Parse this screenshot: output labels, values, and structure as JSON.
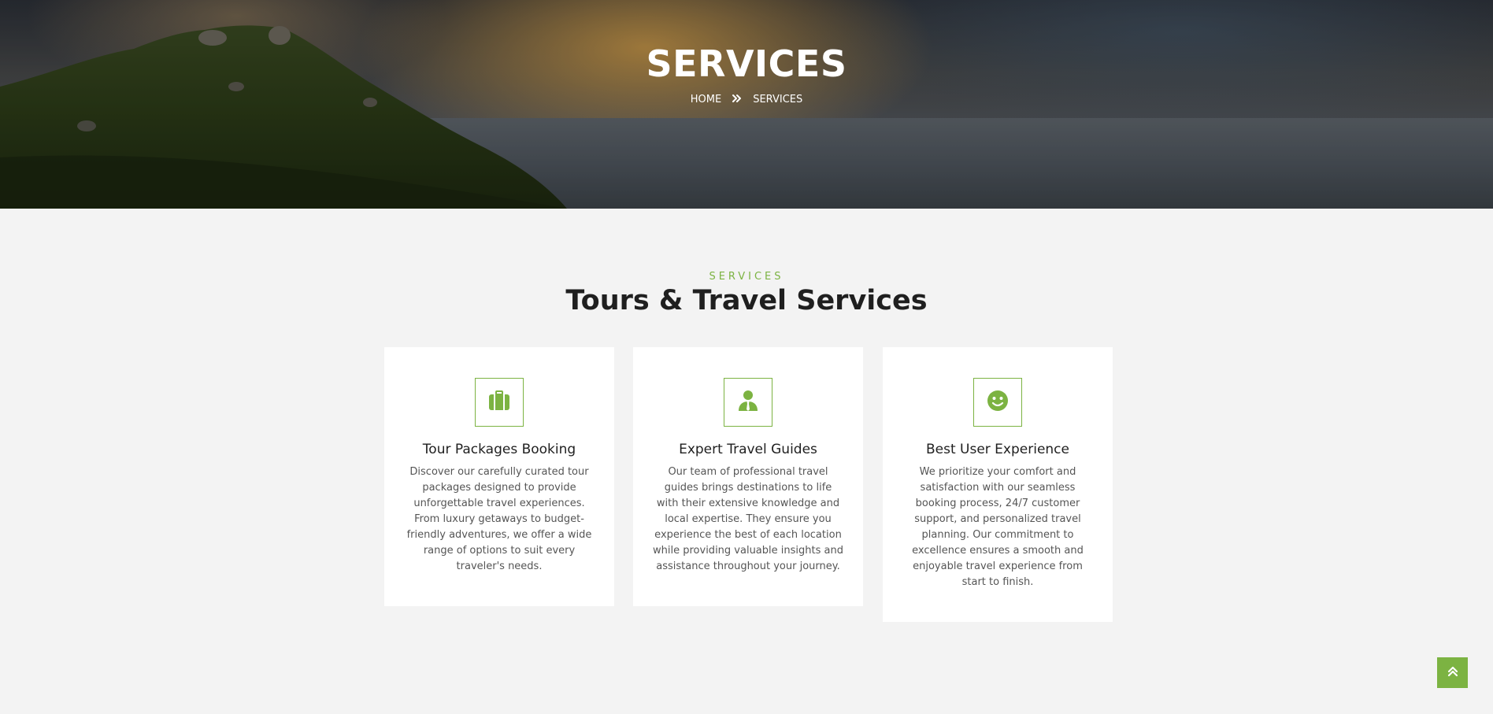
{
  "hero": {
    "title": "SERVICES",
    "breadcrumb": {
      "home": "HOME",
      "separator_icon": "double-chevron-right-icon",
      "current": "SERVICES"
    }
  },
  "section": {
    "eyebrow": "SERVICES",
    "title": "Tours & Travel Services"
  },
  "cards": [
    {
      "icon": "suitcase-icon",
      "title": "Tour Packages Booking",
      "text": "Discover our carefully curated tour packages designed to provide unforgettable travel experiences. From luxury getaways to budget-friendly adventures, we offer a wide range of options to suit every traveler's needs."
    },
    {
      "icon": "user-tie-icon",
      "title": "Expert Travel Guides",
      "text": "Our team of professional travel guides brings destinations to life with their extensive knowledge and local expertise. They ensure you experience the best of each location while providing valuable insights and assistance throughout your journey."
    },
    {
      "icon": "smile-icon",
      "title": "Best User Experience",
      "text": "We prioritize your comfort and satisfaction with our seamless booking process, 24/7 customer support, and personalized travel planning. Our commitment to excellence ensures a smooth and enjoyable travel experience from start to finish."
    }
  ],
  "scroll_top": {
    "icon": "double-chevron-up-icon"
  },
  "colors": {
    "accent": "#7cb342",
    "background": "#f3f3f3",
    "card": "#ffffff",
    "heading": "#1f1f1f",
    "body_text": "#555555"
  }
}
